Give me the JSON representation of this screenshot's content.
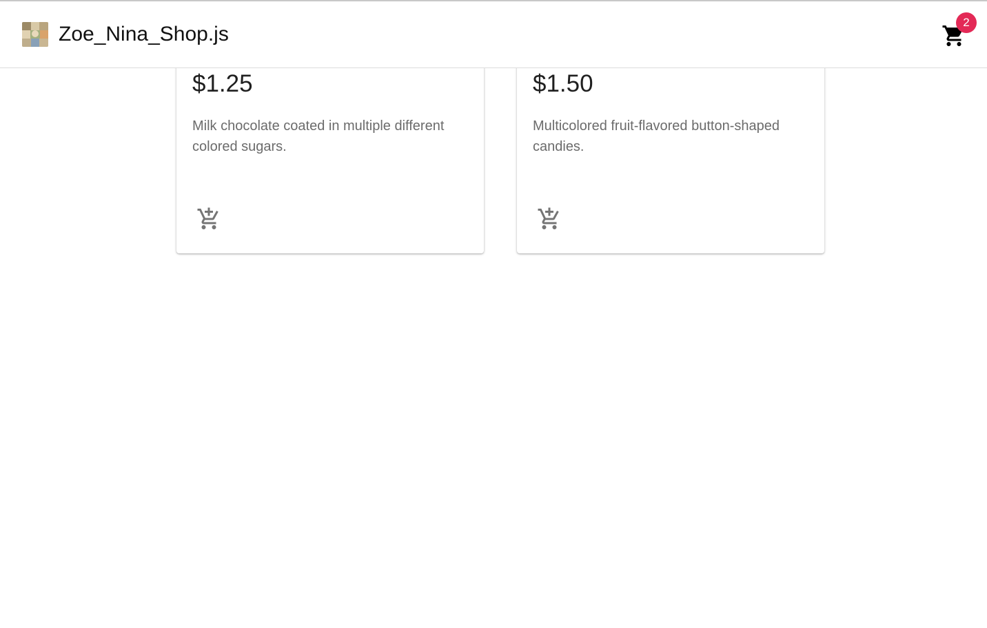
{
  "app": {
    "title": "Zoe_Nina_Shop.js",
    "logo_icon": "shop-logo-image"
  },
  "cart": {
    "icon": "shopping-cart-icon",
    "badge_count": "2",
    "badge_color": "#e32956"
  },
  "products": [
    {
      "price": "$1.25",
      "description": "Milk chocolate coated in multiple different colored sugars.",
      "action_icon": "add-shopping-cart-icon"
    },
    {
      "price": "$1.50",
      "description": "Multicolored fruit-flavored button-shaped candies.",
      "action_icon": "add-shopping-cart-icon"
    }
  ]
}
